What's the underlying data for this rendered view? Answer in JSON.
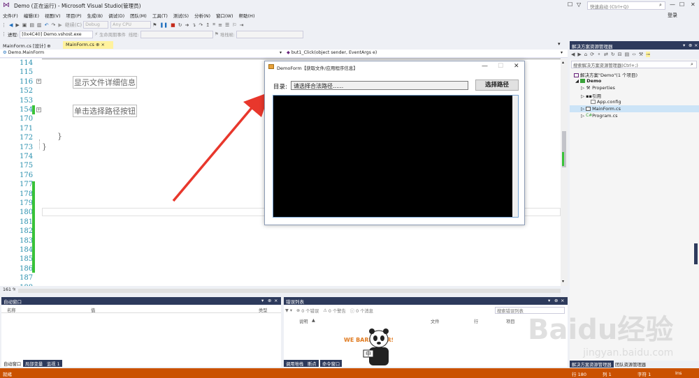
{
  "app": {
    "title": "Demo (正在运行) - Microsoft Visual Studio(管理员)",
    "quick_launch_placeholder": "快速启动 (Ctrl+Q)",
    "login": "登录"
  },
  "menu": [
    "文件(F)",
    "编辑(E)",
    "视图(V)",
    "项目(P)",
    "生成(B)",
    "调试(D)",
    "团队(M)",
    "工具(T)",
    "测试(S)",
    "分析(N)",
    "窗口(W)",
    "帮助(H)"
  ],
  "toolbar": {
    "continue_label": "继续(C)",
    "config": "Debug",
    "platform": "Any CPU",
    "process_label": "进程:",
    "process_value": "[0x4C40] Demo.vshost.exe",
    "lifecycle_label": "生命周期事件",
    "thread_label": "线程:",
    "stack_label": "堆栈帧:"
  },
  "editor": {
    "tabs": [
      {
        "label": "MainForm.cs [设计]",
        "pinned": "⊕",
        "active": false
      },
      {
        "label": "MainForm.cs",
        "pinned": "⊕",
        "close": "×",
        "active": true
      }
    ],
    "nav_class": "Demo.MainForm",
    "nav_member": "but1_Click(object sender, EventArgs e)",
    "line_numbers": [
      "114",
      "115",
      "116",
      "152",
      "153",
      "154",
      "170",
      "171",
      "172",
      "173",
      "174",
      "175",
      "176",
      "177",
      "178",
      "179",
      "180",
      "181",
      "182",
      "183",
      "184",
      "185",
      "186",
      "187",
      "188"
    ],
    "region_texts": [
      "显示文件详细信息",
      "单击选择路径按钮"
    ],
    "braces": [
      "}",
      "}"
    ],
    "zoom": "161 %"
  },
  "form": {
    "title": "DemoForm【获取文件/应用程序信息】",
    "dir_label": "目录:",
    "path_placeholder": "请选择合法路径......",
    "select_button": "选择路径"
  },
  "solution_explorer": {
    "title": "解决方案资源管理器",
    "search_placeholder": "搜索解决方案资源管理器(Ctrl+;)",
    "solution_node": "解决方案\"Demo\"(1 个项目)",
    "project": "Demo",
    "items": [
      "Properties",
      "引用",
      "App.config",
      "MainForm.cs",
      "Program.cs"
    ],
    "bottom_tabs": [
      "解决方案资源管理器",
      "团队资源管理器"
    ]
  },
  "auto_window": {
    "title": "自动窗口",
    "columns": [
      "名称",
      "值",
      "类型"
    ],
    "tabs": [
      "自动窗口",
      "局部变量",
      "监视 1"
    ]
  },
  "error_list": {
    "title": "错误列表",
    "errors": "0 个错误",
    "warnings": "0 个警告",
    "messages": "0 个消息",
    "search_placeholder": "搜索错误列表",
    "columns": [
      "说明",
      "文件",
      "行",
      "项目"
    ],
    "tabs": [
      "调用堆栈",
      "断点",
      "命令窗口"
    ]
  },
  "status_bar": {
    "state": "就绪",
    "line": "行 180",
    "col": "列 1",
    "char": "字符 1",
    "mode": "Ins"
  },
  "watermark": {
    "brand": "Baidu经验",
    "url": "jingyan.baidu.com"
  },
  "sticker": {
    "text": "WE BARE BEARS",
    "badge": "中"
  },
  "colors": {
    "accent": "#68217a",
    "status": "#ca5100",
    "panel_header": "#2d3a5c",
    "active_tab": "#fff29d",
    "change_mark": "#39c239",
    "arrow": "#e8372c"
  }
}
